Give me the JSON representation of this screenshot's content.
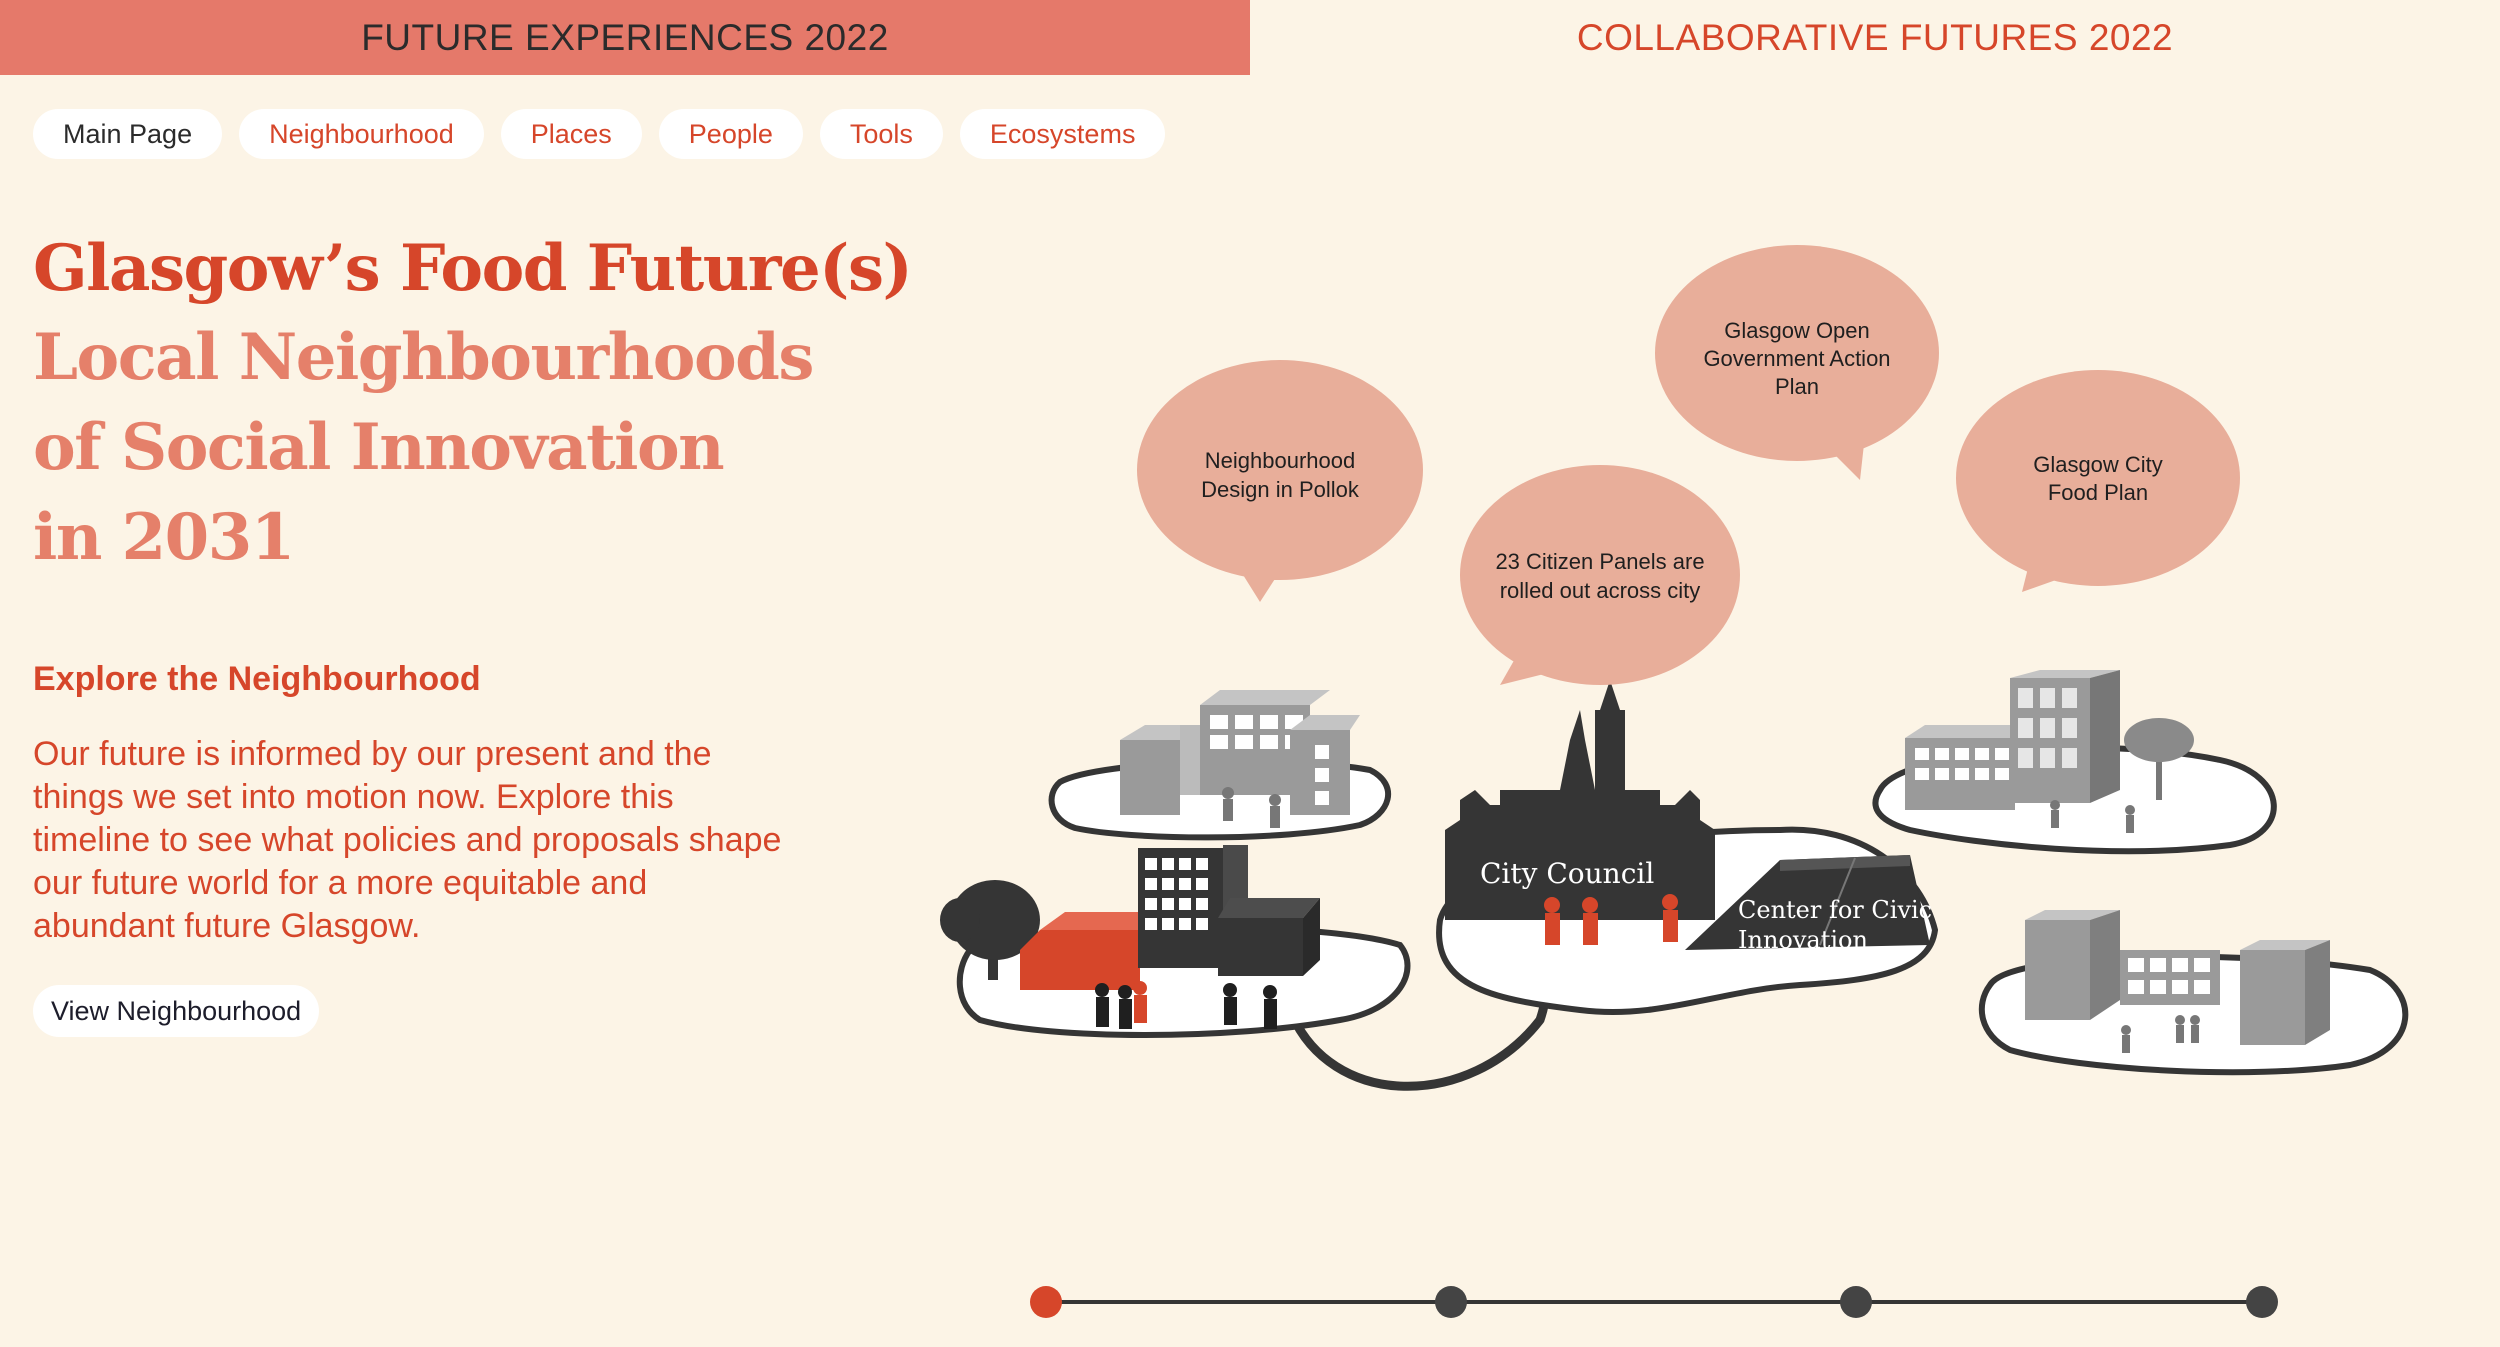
{
  "topbar": {
    "left_tab": "FUTURE EXPERIENCES 2022",
    "right_tab": "COLLABORATIVE FUTURES 2022"
  },
  "nav": {
    "items": [
      {
        "label": "Main Page",
        "active": true
      },
      {
        "label": "Neighbourhood",
        "active": false
      },
      {
        "label": "Places",
        "active": false
      },
      {
        "label": "People",
        "active": false
      },
      {
        "label": "Tools",
        "active": false
      },
      {
        "label": "Ecosystems",
        "active": false
      }
    ]
  },
  "hero": {
    "title": "Glasgow’s Food Future(s)",
    "subtitle": "Local Neighbourhoods\nof Social Innovation\nin 2031",
    "section_heading": "Explore the Neighbourhood",
    "description": "Our future is informed by our present and the things we set into motion now. Explore this timeline to see what policies and proposals shape our future world for a more equitable and abundant future Glasgow.",
    "cta_label": "View Neighbourhood"
  },
  "illustration": {
    "bubbles": [
      {
        "line1": "Neighbourhood",
        "line2": "Design in Pollok",
        "line3": ""
      },
      {
        "line1": "23 Citizen Panels are",
        "line2": "rolled out across city",
        "line3": ""
      },
      {
        "line1": "Glasgow Open",
        "line2": "Government Action",
        "line3": "Plan"
      },
      {
        "line1": "Glasgow City",
        "line2": "Food Plan",
        "line3": ""
      }
    ],
    "city_council_label": "City Council",
    "civic_label_line1": "Center for Civic",
    "civic_label_line2": "Innovation"
  },
  "timeline": {
    "points": 4,
    "active_index": 0
  },
  "colors": {
    "background": "#fcf4e6",
    "accent": "#d6462a",
    "tab_active": "#e5796a",
    "bubble": "#e8ae9a",
    "building_dark": "#353535",
    "building_grey": "#9a9a9a",
    "island": "#ffffff"
  }
}
